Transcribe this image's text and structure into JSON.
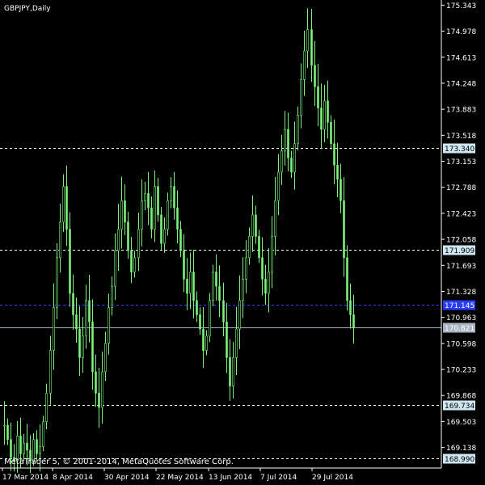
{
  "chart_data": {
    "type": "candlestick",
    "symbol_label": "GBPJPY,Daily",
    "copyright": "MetaTrader 5, © 2001-2014, MetaQuotes Software Corp.",
    "ylim": [
      168.85,
      175.37
    ],
    "y_ticks": [
      "175.343",
      "174.978",
      "174.613",
      "174.248",
      "173.883",
      "173.518",
      "173.153",
      "172.788",
      "172.423",
      "172.058",
      "171.693",
      "171.328",
      "170.963",
      "170.598",
      "170.233",
      "169.868",
      "169.503",
      "169.138"
    ],
    "x_ticks": [
      "17 Mar 2014",
      "8 Apr 2014",
      "30 Apr 2014",
      "22 May 2014",
      "13 Jun 2014",
      "7 Jul 2014",
      "29 Jul 2014"
    ],
    "price_levels": [
      {
        "label": "173.340",
        "value": 173.34,
        "style": "dashed",
        "color": "#ffffff",
        "box_color": "#cde6f0"
      },
      {
        "label": "171.909",
        "value": 171.909,
        "style": "dashed",
        "color": "#ffffff",
        "box_color": "#cde6f0"
      },
      {
        "label": "171.145",
        "value": 171.145,
        "style": "dashed",
        "color": "#2a3cff",
        "box_color": "#2a3cff"
      },
      {
        "label": "170.821",
        "value": 170.821,
        "style": "solid",
        "color": "#a9b4c2",
        "box_color": "#a9b4c2"
      },
      {
        "label": "169.734",
        "value": 169.734,
        "style": "dashed",
        "color": "#ffffff",
        "box_color": "#cde6f0"
      },
      {
        "label": "168.990",
        "value": 168.99,
        "style": "dashed",
        "color": "#ffffff",
        "box_color": "#cde6f0"
      }
    ],
    "colors": {
      "background": "#000000",
      "candle": "#7cf27c",
      "axis": "#ffffff",
      "text": "#ffffff"
    },
    "bar_count": 108,
    "closes": [
      169.45,
      169.25,
      169.0,
      168.95,
      169.3,
      169.05,
      169.2,
      169.1,
      168.95,
      169.25,
      169.05,
      169.15,
      169.5,
      169.9,
      170.5,
      171.1,
      171.8,
      172.3,
      172.8,
      172.2,
      171.3,
      171.0,
      170.8,
      170.4,
      170.7,
      171.2,
      170.9,
      170.2,
      169.9,
      169.7,
      170.2,
      170.6,
      171.1,
      171.4,
      171.9,
      172.2,
      172.6,
      172.3,
      171.9,
      171.6,
      171.8,
      172.2,
      172.6,
      172.7,
      172.5,
      172.2,
      172.8,
      172.4,
      172.0,
      172.2,
      172.6,
      172.8,
      172.5,
      172.2,
      171.9,
      171.5,
      171.3,
      171.6,
      171.2,
      171.0,
      170.8,
      170.5,
      170.7,
      171.2,
      171.6,
      171.4,
      171.2,
      170.9,
      170.4,
      170.0,
      170.4,
      170.8,
      171.2,
      171.5,
      171.8,
      172.1,
      172.4,
      172.1,
      171.8,
      171.5,
      171.3,
      171.6,
      172.1,
      172.6,
      173.0,
      173.3,
      173.6,
      173.2,
      173.0,
      173.4,
      173.8,
      174.3,
      174.7,
      175.0,
      174.5,
      174.2,
      173.9,
      173.6,
      174.0,
      173.7,
      173.4,
      173.1,
      172.9,
      172.6,
      171.8,
      171.2,
      171.0,
      170.821
    ]
  }
}
